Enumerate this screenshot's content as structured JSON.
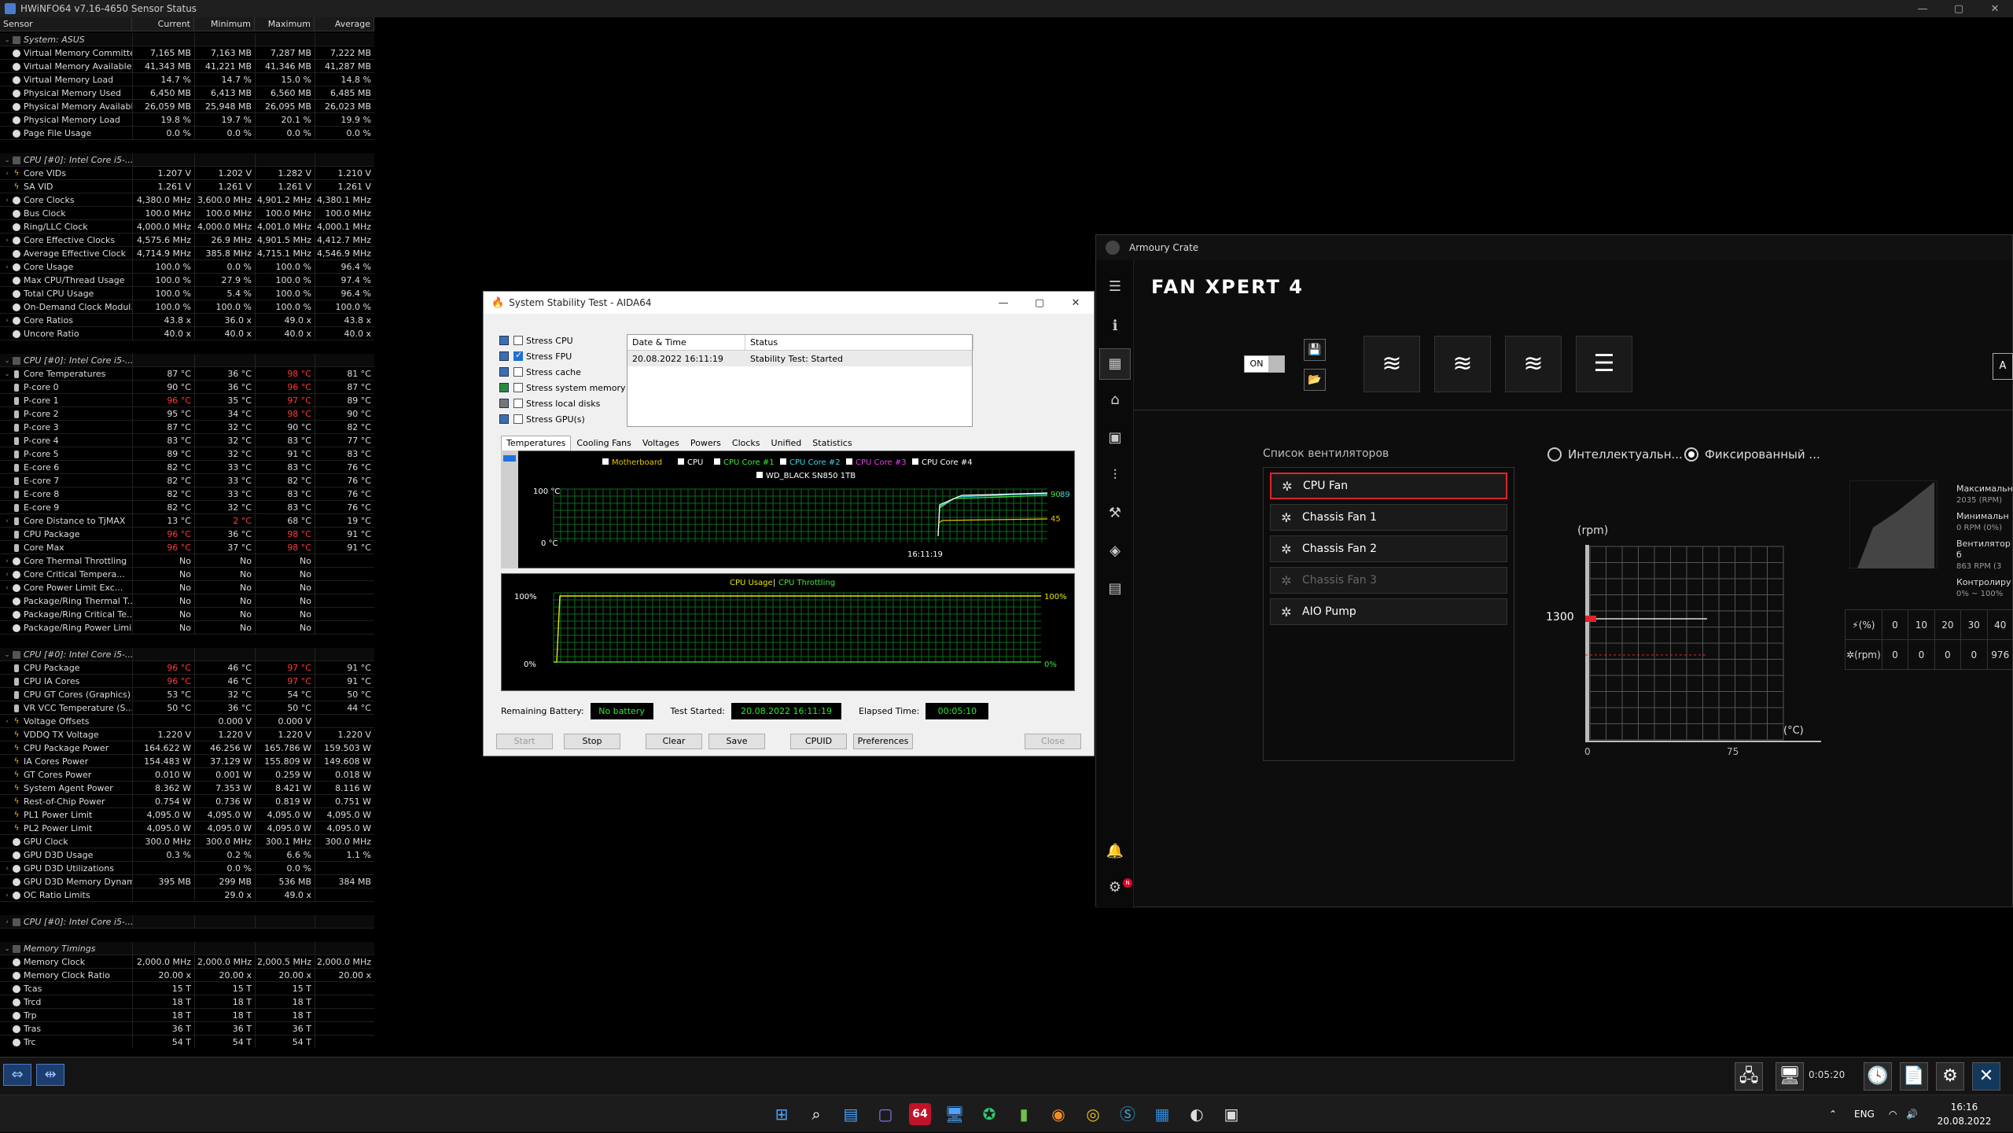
{
  "hwinfo": {
    "title": "HWiNFO64 v7.16-4650 Sensor Status",
    "columns": [
      "Sensor",
      "Current",
      "Minimum",
      "Maximum",
      "Average"
    ],
    "rows": [
      {
        "type": "group",
        "name": "System: ASUS"
      },
      {
        "type": "item",
        "name": "Virtual Memory Committed",
        "v": [
          "7,165 MB",
          "7,163 MB",
          "7,287 MB",
          "7,222 MB"
        ]
      },
      {
        "type": "item",
        "name": "Virtual Memory Available",
        "v": [
          "41,343 MB",
          "41,221 MB",
          "41,346 MB",
          "41,287 MB"
        ]
      },
      {
        "type": "item",
        "name": "Virtual Memory Load",
        "v": [
          "14.7 %",
          "14.7 %",
          "15.0 %",
          "14.8 %"
        ]
      },
      {
        "type": "item",
        "name": "Physical Memory Used",
        "v": [
          "6,450 MB",
          "6,413 MB",
          "6,560 MB",
          "6,485 MB"
        ]
      },
      {
        "type": "item",
        "name": "Physical Memory Available",
        "v": [
          "26,059 MB",
          "25,948 MB",
          "26,095 MB",
          "26,023 MB"
        ]
      },
      {
        "type": "item",
        "name": "Physical Memory Load",
        "v": [
          "19.8 %",
          "19.7 %",
          "20.1 %",
          "19.9 %"
        ]
      },
      {
        "type": "item",
        "name": "Page File Usage",
        "v": [
          "0.0 %",
          "0.0 %",
          "0.0 %",
          "0.0 %"
        ]
      },
      {
        "type": "blank"
      },
      {
        "type": "group",
        "name": "CPU [#0]: Intel Core i5-..."
      },
      {
        "type": "item",
        "ic": "bolt",
        "tw": ">",
        "name": "Core VIDs",
        "v": [
          "1.207 V",
          "1.202 V",
          "1.282 V",
          "1.210 V"
        ]
      },
      {
        "type": "item",
        "ic": "bolt",
        "name": "SA VID",
        "v": [
          "1.261 V",
          "1.261 V",
          "1.261 V",
          "1.261 V"
        ]
      },
      {
        "type": "item",
        "tw": ">",
        "name": "Core Clocks",
        "v": [
          "4,380.0 MHz",
          "3,600.0 MHz",
          "4,901.2 MHz",
          "4,380.1 MHz"
        ]
      },
      {
        "type": "item",
        "name": "Bus Clock",
        "v": [
          "100.0 MHz",
          "100.0 MHz",
          "100.0 MHz",
          "100.0 MHz"
        ]
      },
      {
        "type": "item",
        "name": "Ring/LLC Clock",
        "v": [
          "4,000.0 MHz",
          "4,000.0 MHz",
          "4,001.0 MHz",
          "4,000.1 MHz"
        ]
      },
      {
        "type": "item",
        "tw": ">",
        "name": "Core Effective Clocks",
        "v": [
          "4,575.6 MHz",
          "26.9 MHz",
          "4,901.5 MHz",
          "4,412.7 MHz"
        ]
      },
      {
        "type": "item",
        "name": "Average Effective Clock",
        "v": [
          "4,714.9 MHz",
          "385.8 MHz",
          "4,715.1 MHz",
          "4,546.9 MHz"
        ]
      },
      {
        "type": "item",
        "tw": ">",
        "name": "Core Usage",
        "v": [
          "100.0 %",
          "0.0 %",
          "100.0 %",
          "96.4 %"
        ]
      },
      {
        "type": "item",
        "name": "Max CPU/Thread Usage",
        "v": [
          "100.0 %",
          "27.9 %",
          "100.0 %",
          "97.4 %"
        ]
      },
      {
        "type": "item",
        "name": "Total CPU Usage",
        "v": [
          "100.0 %",
          "5.4 %",
          "100.0 %",
          "96.4 %"
        ]
      },
      {
        "type": "item",
        "name": "On-Demand Clock Modul...",
        "v": [
          "100.0 %",
          "100.0 %",
          "100.0 %",
          "100.0 %"
        ]
      },
      {
        "type": "item",
        "tw": ">",
        "name": "Core Ratios",
        "v": [
          "43.8 x",
          "36.0 x",
          "49.0 x",
          "43.8 x"
        ]
      },
      {
        "type": "item",
        "name": "Uncore Ratio",
        "v": [
          "40.0 x",
          "40.0 x",
          "40.0 x",
          "40.0 x"
        ]
      },
      {
        "type": "blank"
      },
      {
        "type": "group",
        "name": "CPU [#0]: Intel Core i5-..."
      },
      {
        "type": "item",
        "ic": "therm",
        "tw": "v",
        "name": "Core Temperatures",
        "v": [
          "87 °C",
          "36 °C",
          "98 °C",
          "81 °C"
        ],
        "red": [
          2
        ]
      },
      {
        "type": "item",
        "ic": "therm",
        "sub": true,
        "name": "P-core 0",
        "v": [
          "90 °C",
          "36 °C",
          "96 °C",
          "87 °C"
        ],
        "red": [
          2
        ]
      },
      {
        "type": "item",
        "ic": "therm",
        "sub": true,
        "name": "P-core 1",
        "v": [
          "96 °C",
          "35 °C",
          "97 °C",
          "89 °C"
        ],
        "red": [
          0,
          2
        ]
      },
      {
        "type": "item",
        "ic": "therm",
        "sub": true,
        "name": "P-core 2",
        "v": [
          "95 °C",
          "34 °C",
          "98 °C",
          "90 °C"
        ],
        "red": [
          2
        ]
      },
      {
        "type": "item",
        "ic": "therm",
        "sub": true,
        "name": "P-core 3",
        "v": [
          "87 °C",
          "32 °C",
          "90 °C",
          "82 °C"
        ]
      },
      {
        "type": "item",
        "ic": "therm",
        "sub": true,
        "name": "P-core 4",
        "v": [
          "83 °C",
          "32 °C",
          "83 °C",
          "77 °C"
        ]
      },
      {
        "type": "item",
        "ic": "therm",
        "sub": true,
        "name": "P-core 5",
        "v": [
          "89 °C",
          "32 °C",
          "91 °C",
          "83 °C"
        ]
      },
      {
        "type": "item",
        "ic": "therm",
        "sub": true,
        "name": "E-core 6",
        "v": [
          "82 °C",
          "33 °C",
          "83 °C",
          "76 °C"
        ]
      },
      {
        "type": "item",
        "ic": "therm",
        "sub": true,
        "name": "E-core 7",
        "v": [
          "82 °C",
          "33 °C",
          "82 °C",
          "76 °C"
        ]
      },
      {
        "type": "item",
        "ic": "therm",
        "sub": true,
        "name": "E-core 8",
        "v": [
          "82 °C",
          "33 °C",
          "83 °C",
          "76 °C"
        ]
      },
      {
        "type": "item",
        "ic": "therm",
        "sub": true,
        "name": "E-core 9",
        "v": [
          "82 °C",
          "32 °C",
          "83 °C",
          "76 °C"
        ]
      },
      {
        "type": "item",
        "ic": "therm",
        "tw": ">",
        "name": "Core Distance to TjMAX",
        "v": [
          "13 °C",
          "2 °C",
          "68 °C",
          "19 °C"
        ],
        "red": [
          1
        ]
      },
      {
        "type": "item",
        "ic": "therm",
        "name": "CPU Package",
        "v": [
          "96 °C",
          "36 °C",
          "98 °C",
          "91 °C"
        ],
        "red": [
          0,
          2
        ]
      },
      {
        "type": "item",
        "ic": "therm",
        "name": "Core Max",
        "v": [
          "96 °C",
          "37 °C",
          "98 °C",
          "91 °C"
        ],
        "red": [
          0,
          2
        ]
      },
      {
        "type": "item",
        "tw": ">",
        "name": "Core Thermal Throttling",
        "v": [
          "No",
          "No",
          "No",
          ""
        ]
      },
      {
        "type": "item",
        "tw": ">",
        "name": "Core Critical Tempera...",
        "v": [
          "No",
          "No",
          "No",
          ""
        ]
      },
      {
        "type": "item",
        "tw": ">",
        "name": "Core Power Limit Exc...",
        "v": [
          "No",
          "No",
          "No",
          ""
        ]
      },
      {
        "type": "item",
        "name": "Package/Ring Thermal T...",
        "v": [
          "No",
          "No",
          "No",
          ""
        ]
      },
      {
        "type": "item",
        "name": "Package/Ring Critical Te...",
        "v": [
          "No",
          "No",
          "No",
          ""
        ]
      },
      {
        "type": "item",
        "name": "Package/Ring Power Limi...",
        "v": [
          "No",
          "No",
          "No",
          ""
        ]
      },
      {
        "type": "blank"
      },
      {
        "type": "group",
        "name": "CPU [#0]: Intel Core i5-..."
      },
      {
        "type": "item",
        "ic": "therm",
        "name": "CPU Package",
        "v": [
          "96 °C",
          "46 °C",
          "97 °C",
          "91 °C"
        ],
        "red": [
          0,
          2
        ]
      },
      {
        "type": "item",
        "ic": "therm",
        "name": "CPU IA Cores",
        "v": [
          "96 °C",
          "46 °C",
          "97 °C",
          "91 °C"
        ],
        "red": [
          0,
          2
        ]
      },
      {
        "type": "item",
        "ic": "therm",
        "name": "CPU GT Cores (Graphics)",
        "v": [
          "53 °C",
          "32 °C",
          "54 °C",
          "50 °C"
        ]
      },
      {
        "type": "item",
        "ic": "therm",
        "name": "VR VCC Temperature (S...",
        "v": [
          "50 °C",
          "36 °C",
          "50 °C",
          "44 °C"
        ]
      },
      {
        "type": "item",
        "ic": "bolt",
        "tw": ">",
        "name": "Voltage Offsets",
        "v": [
          "",
          "0.000 V",
          "0.000 V",
          ""
        ]
      },
      {
        "type": "item",
        "ic": "bolt",
        "name": "VDDQ TX Voltage",
        "v": [
          "1.220 V",
          "1.220 V",
          "1.220 V",
          "1.220 V"
        ]
      },
      {
        "type": "item",
        "ic": "bolt",
        "name": "CPU Package Power",
        "v": [
          "164.622 W",
          "46.256 W",
          "165.786 W",
          "159.503 W"
        ]
      },
      {
        "type": "item",
        "ic": "bolt",
        "name": "IA Cores Power",
        "v": [
          "154.483 W",
          "37.129 W",
          "155.809 W",
          "149.608 W"
        ]
      },
      {
        "type": "item",
        "ic": "bolt",
        "name": "GT Cores Power",
        "v": [
          "0.010 W",
          "0.001 W",
          "0.259 W",
          "0.018 W"
        ]
      },
      {
        "type": "item",
        "ic": "bolt",
        "name": "System Agent Power",
        "v": [
          "8.362 W",
          "7.353 W",
          "8.421 W",
          "8.116 W"
        ]
      },
      {
        "type": "item",
        "ic": "bolt",
        "name": "Rest-of-Chip Power",
        "v": [
          "0.754 W",
          "0.736 W",
          "0.819 W",
          "0.751 W"
        ]
      },
      {
        "type": "item",
        "ic": "bolt",
        "name": "PL1 Power Limit",
        "v": [
          "4,095.0 W",
          "4,095.0 W",
          "4,095.0 W",
          "4,095.0 W"
        ]
      },
      {
        "type": "item",
        "ic": "bolt",
        "name": "PL2 Power Limit",
        "v": [
          "4,095.0 W",
          "4,095.0 W",
          "4,095.0 W",
          "4,095.0 W"
        ]
      },
      {
        "type": "item",
        "name": "GPU Clock",
        "v": [
          "300.0 MHz",
          "300.0 MHz",
          "300.1 MHz",
          "300.0 MHz"
        ]
      },
      {
        "type": "item",
        "name": "GPU D3D Usage",
        "v": [
          "0.3 %",
          "0.2 %",
          "6.6 %",
          "1.1 %"
        ]
      },
      {
        "type": "item",
        "tw": ">",
        "name": "GPU D3D Utilizations",
        "v": [
          "",
          "0.0 %",
          "0.0 %",
          ""
        ]
      },
      {
        "type": "item",
        "name": "GPU D3D Memory Dynamic",
        "v": [
          "395 MB",
          "299 MB",
          "536 MB",
          "384 MB"
        ]
      },
      {
        "type": "item",
        "tw": ">",
        "name": "OC Ratio Limits",
        "v": [
          "",
          "29.0 x",
          "49.0 x",
          ""
        ]
      },
      {
        "type": "blank"
      },
      {
        "type": "group",
        "tw": ">",
        "name": "CPU [#0]: Intel Core i5-..."
      },
      {
        "type": "blank"
      },
      {
        "type": "group",
        "name": "Memory Timings"
      },
      {
        "type": "item",
        "name": "Memory Clock",
        "v": [
          "2,000.0 MHz",
          "2,000.0 MHz",
          "2,000.5 MHz",
          "2,000.0 MHz"
        ]
      },
      {
        "type": "item",
        "name": "Memory Clock Ratio",
        "v": [
          "20.00 x",
          "20.00 x",
          "20.00 x",
          "20.00 x"
        ]
      },
      {
        "type": "item",
        "name": "Tcas",
        "v": [
          "15 T",
          "15 T",
          "15 T",
          ""
        ]
      },
      {
        "type": "item",
        "name": "Trcd",
        "v": [
          "18 T",
          "18 T",
          "18 T",
          ""
        ]
      },
      {
        "type": "item",
        "name": "Trp",
        "v": [
          "18 T",
          "18 T",
          "18 T",
          ""
        ]
      },
      {
        "type": "item",
        "name": "Tras",
        "v": [
          "36 T",
          "36 T",
          "36 T",
          ""
        ]
      },
      {
        "type": "item",
        "name": "Trc",
        "v": [
          "54 T",
          "54 T",
          "54 T",
          ""
        ]
      }
    ],
    "timer": "0:05:20"
  },
  "aida": {
    "title": "System Stability Test - AIDA64",
    "checks": [
      {
        "label": "Stress CPU",
        "checked": false
      },
      {
        "label": "Stress FPU",
        "checked": true
      },
      {
        "label": "Stress cache",
        "checked": false
      },
      {
        "label": "Stress system memory",
        "checked": false
      },
      {
        "label": "Stress local disks",
        "checked": false
      },
      {
        "label": "Stress GPU(s)",
        "checked": false
      }
    ],
    "status_headers": [
      "Date & Time",
      "Status"
    ],
    "status_row": [
      "20.08.2022 16:11:19",
      "Stability Test: Started"
    ],
    "tabs": [
      "Temperatures",
      "Cooling Fans",
      "Voltages",
      "Powers",
      "Clocks",
      "Unified",
      "Statistics"
    ],
    "legend1": [
      {
        "label": "Motherboard",
        "color": "#e8c600"
      },
      {
        "label": "CPU",
        "color": "#ffffff"
      },
      {
        "label": "CPU Core #1",
        "color": "#3fe83f"
      },
      {
        "label": "CPU Core #2",
        "color": "#3fd8e8"
      },
      {
        "label": "CPU Core #3",
        "color": "#e83fe8"
      },
      {
        "label": "CPU Core #4",
        "color": "#ffffff"
      }
    ],
    "legend1b": "WD_BLACK SN850 1TB",
    "graph1_ymax": "100 °C",
    "graph1_ymin": "0 °C",
    "graph1_time": "16:11:19",
    "graph1_vals": [
      "90",
      "89",
      "45"
    ],
    "graph2_title1": "CPU Usage",
    "graph2_sep": "|",
    "graph2_title2": "CPU Throttling",
    "graph2_ytop": "100%",
    "graph2_ybot": "0%",
    "graph2_rtop": "100%",
    "graph2_rbot": "0%",
    "battery_label": "Remaining Battery:",
    "battery_value": "No battery",
    "started_label": "Test Started:",
    "started_value": "20.08.2022 16:11:19",
    "elapsed_label": "Elapsed Time:",
    "elapsed_value": "00:05:10",
    "buttons": [
      "Start",
      "Stop",
      "Clear",
      "Save",
      "CPUID",
      "Preferences",
      "Close"
    ]
  },
  "armoury": {
    "window_title": "Armoury Crate",
    "heading": "FAN XPERT 4",
    "toggle": "ON",
    "edge_button": "A",
    "fanlist_title": "Список вентиляторов",
    "fans": [
      {
        "label": "CPU Fan",
        "selected": true,
        "disabled": false
      },
      {
        "label": "Chassis Fan 1",
        "selected": false,
        "disabled": false
      },
      {
        "label": "Chassis Fan 2",
        "selected": false,
        "disabled": false
      },
      {
        "label": "Chassis Fan 3",
        "selected": false,
        "disabled": true
      },
      {
        "label": "AIO Pump",
        "selected": false,
        "disabled": false
      }
    ],
    "radio_smart": "Интеллектуальн...",
    "radio_fixed": "Фиксированный ...",
    "rpm_axis_label": "(rpm)",
    "celsius_axis_label": "(°C)",
    "fixed_rpm": "1300",
    "x_ticks": [
      "0",
      "75"
    ],
    "stats": [
      {
        "label": "Максимальн",
        "value": "2035 (RPM)"
      },
      {
        "label": "Минимальн",
        "value": "0 RPM (0%)"
      },
      {
        "label": "Вентилятор б",
        "value": "863 RPM (3"
      },
      {
        "label": "Контролиру",
        "value": "0% ~ 100%"
      }
    ],
    "table_row1_unit": "(%)",
    "table_row1": [
      "0",
      "10",
      "20",
      "30",
      "40"
    ],
    "table_row2_unit": "(rpm)",
    "table_row2": [
      "0",
      "0",
      "0",
      "0",
      "976"
    ]
  },
  "taskbar": {
    "lang": "ENG",
    "time": "16:16",
    "date": "20.08.2022",
    "app_badge": "64"
  }
}
